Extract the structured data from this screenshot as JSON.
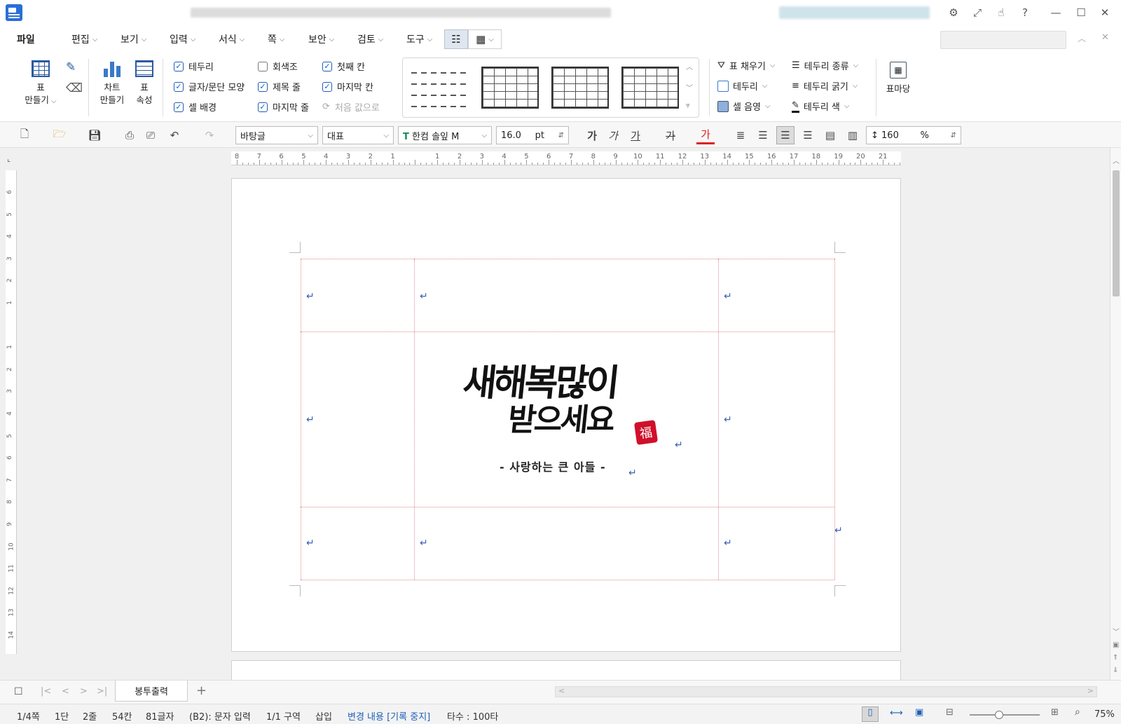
{
  "menu": {
    "file": "파일",
    "items": [
      "편집",
      "보기",
      "입력",
      "서식",
      "쪽",
      "보안",
      "검토",
      "도구"
    ]
  },
  "ribbon": {
    "table_create": "표\n만들기",
    "chart_create": "차트\n만들기",
    "table_props": "표\n속성",
    "checks": [
      {
        "label": "테두리",
        "checked": true
      },
      {
        "label": "회색조",
        "checked": false
      },
      {
        "label": "첫째 칸",
        "checked": true
      },
      {
        "label": "글자/문단 모양",
        "checked": true
      },
      {
        "label": "제목 줄",
        "checked": true
      },
      {
        "label": "마지막 칸",
        "checked": true
      },
      {
        "label": "셀 배경",
        "checked": true
      },
      {
        "label": "마지막 줄",
        "checked": true
      }
    ],
    "reset_label": "처음 값으로",
    "fill": "표 채우기",
    "border": "테두리",
    "shade": "셀 음영",
    "border_type": "테두리 종류",
    "border_width": "테두리 굵기",
    "border_color": "테두리 색",
    "table_madang": "표마당"
  },
  "format": {
    "style": "바탕글",
    "lang": "대표",
    "font": "한컴 솔잎 M",
    "size": "16.0",
    "unit": "pt",
    "line_spacing": "160",
    "percent": "%"
  },
  "ruler": {
    "h_numbers": [
      "8",
      "7",
      "6",
      "5",
      "4",
      "3",
      "2",
      "1",
      "",
      "1",
      "2",
      "3",
      "4",
      "5",
      "6",
      "7",
      "8",
      "9",
      "10",
      "11",
      "12",
      "13",
      "14",
      "15",
      "16",
      "17",
      "18",
      "19",
      "20",
      "21"
    ],
    "v_numbers": [
      "6",
      "5",
      "4",
      "3",
      "2",
      "1",
      "",
      "1",
      "2",
      "3",
      "4",
      "5",
      "6",
      "7",
      "8",
      "9",
      "10",
      "11",
      "12",
      "13",
      "14"
    ]
  },
  "document": {
    "greeting_line1": "새해복많이",
    "greeting_line2": "받으세요",
    "seal": "福",
    "signature": "- 사랑하는 큰 아들 -"
  },
  "tabs": {
    "sheet": "봉투출력",
    "add": "+"
  },
  "status": {
    "page": "1/4쪽",
    "column": "1단",
    "line": "2줄",
    "col": "54칸",
    "chars": "81글자",
    "cell": "(B2): 문자 입력",
    "section": "1/1 구역",
    "insert": "삽입",
    "track": "변경 내용 [기록 중지]",
    "typing": "타수 : 100타",
    "zoom": "75%"
  }
}
